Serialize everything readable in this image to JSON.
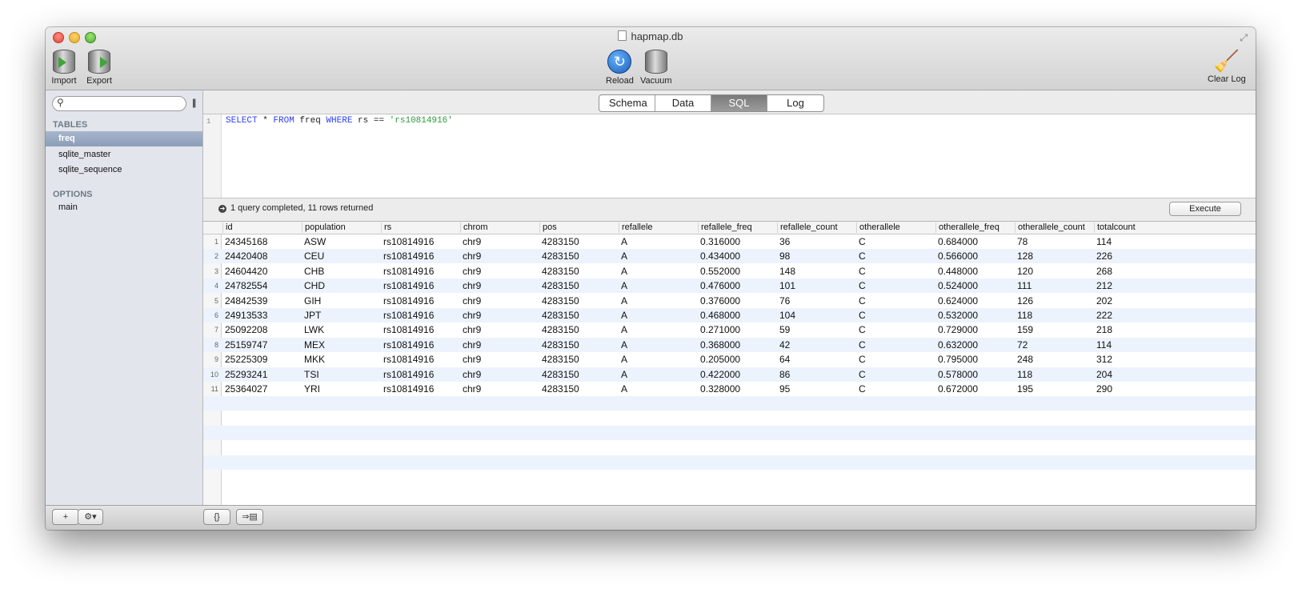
{
  "window": {
    "title": "hapmap.db"
  },
  "toolbar": {
    "import_label": "Import",
    "export_label": "Export",
    "reload_label": "Reload",
    "vacuum_label": "Vacuum",
    "clear_log_label": "Clear Log"
  },
  "sidebar": {
    "search_placeholder": "",
    "tables_header": "TABLES",
    "tables": [
      "freq",
      "sqlite_master",
      "sqlite_sequence"
    ],
    "selected_table": "freq",
    "options_header": "OPTIONS",
    "options": [
      "main"
    ]
  },
  "tabs": [
    "Schema",
    "Data",
    "SQL",
    "Log"
  ],
  "active_tab": "SQL",
  "editor": {
    "line_number": "1",
    "query_parts": [
      {
        "t": "SELECT",
        "k": "kw"
      },
      {
        "t": " * ",
        "k": "plain"
      },
      {
        "t": "FROM",
        "k": "kw"
      },
      {
        "t": " freq ",
        "k": "plain"
      },
      {
        "t": "WHERE",
        "k": "kw"
      },
      {
        "t": " rs == ",
        "k": "plain"
      },
      {
        "t": "'rs10814916'",
        "k": "str"
      }
    ]
  },
  "status": {
    "text": "1 query completed, 11 rows returned",
    "execute_label": "Execute"
  },
  "results": {
    "columns": [
      "id",
      "population",
      "rs",
      "chrom",
      "pos",
      "refallele",
      "refallele_freq",
      "refallele_count",
      "otherallele",
      "otherallele_freq",
      "otherallele_count",
      "totalcount"
    ],
    "rows": [
      [
        "24345168",
        "ASW",
        "rs10814916",
        "chr9",
        "4283150",
        "A",
        "0.316000",
        "36",
        "C",
        "0.684000",
        "78",
        "114"
      ],
      [
        "24420408",
        "CEU",
        "rs10814916",
        "chr9",
        "4283150",
        "A",
        "0.434000",
        "98",
        "C",
        "0.566000",
        "128",
        "226"
      ],
      [
        "24604420",
        "CHB",
        "rs10814916",
        "chr9",
        "4283150",
        "A",
        "0.552000",
        "148",
        "C",
        "0.448000",
        "120",
        "268"
      ],
      [
        "24782554",
        "CHD",
        "rs10814916",
        "chr9",
        "4283150",
        "A",
        "0.476000",
        "101",
        "C",
        "0.524000",
        "111",
        "212"
      ],
      [
        "24842539",
        "GIH",
        "rs10814916",
        "chr9",
        "4283150",
        "A",
        "0.376000",
        "76",
        "C",
        "0.624000",
        "126",
        "202"
      ],
      [
        "24913533",
        "JPT",
        "rs10814916",
        "chr9",
        "4283150",
        "A",
        "0.468000",
        "104",
        "C",
        "0.532000",
        "118",
        "222"
      ],
      [
        "25092208",
        "LWK",
        "rs10814916",
        "chr9",
        "4283150",
        "A",
        "0.271000",
        "59",
        "C",
        "0.729000",
        "159",
        "218"
      ],
      [
        "25159747",
        "MEX",
        "rs10814916",
        "chr9",
        "4283150",
        "A",
        "0.368000",
        "42",
        "C",
        "0.632000",
        "72",
        "114"
      ],
      [
        "25225309",
        "MKK",
        "rs10814916",
        "chr9",
        "4283150",
        "A",
        "0.205000",
        "64",
        "C",
        "0.795000",
        "248",
        "312"
      ],
      [
        "25293241",
        "TSI",
        "rs10814916",
        "chr9",
        "4283150",
        "A",
        "0.422000",
        "86",
        "C",
        "0.578000",
        "118",
        "204"
      ],
      [
        "25364027",
        "YRI",
        "rs10814916",
        "chr9",
        "4283150",
        "A",
        "0.328000",
        "95",
        "C",
        "0.672000",
        "195",
        "290"
      ]
    ]
  },
  "bottombar": {
    "add_label": "+",
    "gear_label": "⚙▾",
    "braces_label": "{}",
    "export_label": "⇒▤"
  }
}
